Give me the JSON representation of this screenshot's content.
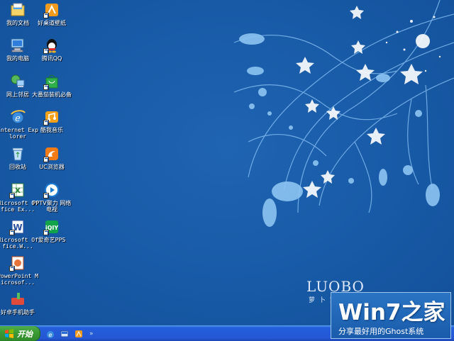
{
  "desktop": {
    "icons": [
      {
        "label": "我的文档",
        "icon": "my-documents-icon"
      },
      {
        "label": "我的电脑",
        "icon": "my-computer-icon"
      },
      {
        "label": "网上邻居",
        "icon": "network-places-icon"
      },
      {
        "label": "Internet Explorer",
        "icon": "internet-explorer-icon"
      },
      {
        "label": "回收站",
        "icon": "recycle-bin-icon"
      },
      {
        "label": "Microsoft Office Ex...",
        "icon": "excel-icon"
      },
      {
        "label": "Microsoft Office.W...",
        "icon": "word-icon"
      },
      {
        "label": "PowerPoint Microsof...",
        "icon": "powerpoint-icon"
      },
      {
        "label": "好卓手机助手",
        "icon": "phone-assistant-icon"
      },
      {
        "label": "好桌道壁纸",
        "icon": "wallpaper-app-icon"
      },
      {
        "label": "腾讯QQ",
        "icon": "qq-icon"
      },
      {
        "label": "大番茄装机必备",
        "icon": "shopping-bag-icon"
      },
      {
        "label": "酷我音乐",
        "icon": "kuwo-music-icon"
      },
      {
        "label": "UC浏览器",
        "icon": "uc-browser-icon"
      },
      {
        "label": "PPTV聚力 网络电视",
        "icon": "pptv-icon"
      },
      {
        "label": "爱奇艺PPS",
        "icon": "iqiyi-icon"
      }
    ]
  },
  "watermark": {
    "brand": "LUOBO",
    "brand_sub": "萝卜家园",
    "title": "Win7之家",
    "subtitle": "分享最好用的Ghost系统"
  },
  "taskbar": {
    "start_label": "开始",
    "quick_launch_chevron": "»"
  },
  "colors": {
    "desktop_bg": "#185aa6",
    "taskbar": "#245edb",
    "start_button": "#3c9c36"
  }
}
